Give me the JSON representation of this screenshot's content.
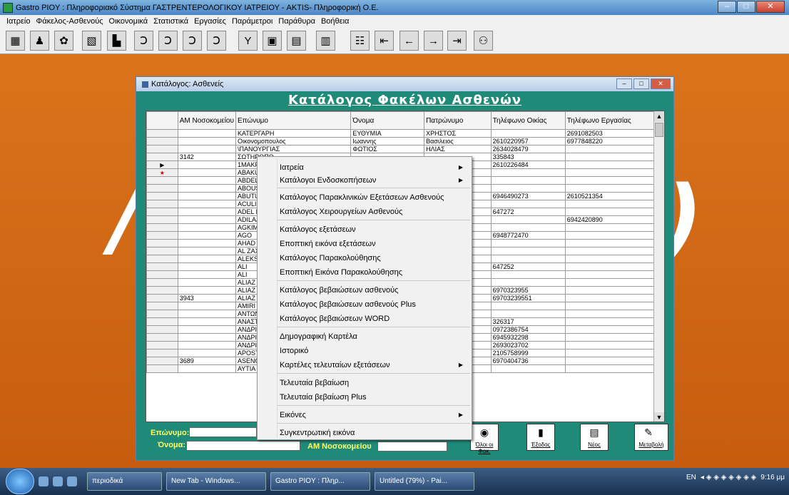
{
  "window": {
    "title": "Gastro PIOY : Πληροφοριακό Σύστημα ΓΑΣΤΡΕΝΤΕΡΟΛΟΓΙΚΟΥ ΙΑΤΡΕΙΟΥ  -    AKTIS- Πληροφορική Ο.Ε."
  },
  "menu": [
    "Ιατρείο",
    "Φάκελος-Ασθενούς",
    "Οικονομικά",
    "Στατιστικά",
    "Εργασίες",
    "Παράμετροι",
    "Παράθυρα",
    "Βοήθεια"
  ],
  "toolbar": {
    "icons": [
      "calculator-icon",
      "people-icon",
      "bag-icon",
      "puzzle-icon",
      "chart-icon",
      "organ-icon",
      "organ-icon",
      "organ-icon",
      "organ-icon",
      "y-icon",
      "monitor-icon",
      "calc-icon",
      "calc2-icon",
      "calendar-icon",
      "arrow-first-icon",
      "arrow-prev-icon",
      "arrow-next-icon",
      "arrow-last-icon",
      "users-icon",
      "exit-icon"
    ]
  },
  "child": {
    "title": "Κατάλογος: Ασθενείς",
    "heading": "Κατάλογος  Φακέλων Ασθενών"
  },
  "grid": {
    "headers": [
      "AM Νοσοκομείου",
      "Επώνυμο",
      "Όνομα",
      "Πατρώνυμο",
      "Τηλέφωνο Οικίας",
      "Τηλέφωνο Εργασίας"
    ],
    "rows": [
      [
        "",
        "",
        "ΚΑΤΕΡΓΑΡΗ",
        "ΕΥΘΥΜΙΑ",
        "ΧΡΗΣΤΟΣ",
        "",
        "2691082503"
      ],
      [
        "",
        "",
        "Οικονομοπουλος",
        "Ιωαννης",
        "Βασιλειος",
        "2610220957",
        "6977848220"
      ],
      [
        "",
        "",
        "\\ΠΑΝΟΥΡΓΙΑΣ",
        "ΦΩΤΙΟΣ",
        "ΗΛΙΑΣ",
        "2634028479",
        ""
      ],
      [
        "",
        "3142",
        "ΣΩΤΗΡΟΠΟ",
        "",
        "",
        "335843",
        ""
      ],
      [
        "▶",
        "",
        "1ΜΑΚΡΗ",
        "",
        "",
        "2610226484",
        ""
      ],
      [
        "★",
        "",
        "ΑΒΑΚUMOV",
        "",
        "",
        "",
        ""
      ],
      [
        "",
        "",
        "ABDELAZIZ",
        "",
        "",
        "",
        ""
      ],
      [
        "",
        "",
        "ABOUSHAN",
        "",
        "",
        "",
        ""
      ],
      [
        "",
        "",
        "ABUTURAB",
        "",
        "",
        "6946490273",
        "2610521354"
      ],
      [
        "",
        "",
        "ACULI",
        "",
        "",
        "",
        ""
      ],
      [
        "",
        "",
        "ADEL MOV",
        "",
        "",
        "647272",
        ""
      ],
      [
        "",
        "",
        "ADILAJ",
        "",
        "",
        "",
        "6942420890"
      ],
      [
        "",
        "",
        "AGKIM",
        "",
        "",
        "",
        ""
      ],
      [
        "",
        "",
        "AGO",
        "",
        "",
        "6948772470",
        ""
      ],
      [
        "",
        "",
        "AHAD",
        "",
        "ALI",
        "",
        ""
      ],
      [
        "",
        "",
        "AL ZAXIEN",
        "",
        "",
        "",
        ""
      ],
      [
        "",
        "",
        "ALEKSAND",
        "",
        "",
        "",
        ""
      ],
      [
        "",
        "",
        "ALI",
        "",
        "",
        "647252",
        ""
      ],
      [
        "",
        "",
        "ALI",
        "",
        "",
        "",
        ""
      ],
      [
        "",
        "",
        "ALIAZ",
        "",
        "",
        "",
        ""
      ],
      [
        "",
        "",
        "ALIAZ",
        "",
        "",
        "6970323955",
        ""
      ],
      [
        "",
        "3943",
        "ALIAZ",
        "",
        "",
        "69703239551",
        ""
      ],
      [
        "",
        "",
        "AMIRI",
        "",
        "",
        "",
        ""
      ],
      [
        "",
        "",
        "ΑΝΤΩΝΟΠ",
        "",
        "",
        "",
        ""
      ],
      [
        "",
        "",
        "ΑΝΑΣΤΑΣΟ",
        "",
        "",
        "326317",
        ""
      ],
      [
        "",
        "",
        "ΑΝΔΡΙΑΚΟΠ",
        "",
        "",
        "0972386754",
        ""
      ],
      [
        "",
        "",
        "ΑΝΔΡΙΑΝΟΙ",
        "",
        "",
        "6945932298",
        ""
      ],
      [
        "",
        "",
        "ΑΝΔΡΙΚΟΠΟ",
        "",
        "",
        "2693023702",
        ""
      ],
      [
        "",
        "",
        "APOSTOL",
        "",
        "",
        "2105758999",
        ""
      ],
      [
        "",
        "3689",
        "ASENOVA",
        "",
        "",
        "6970404736",
        ""
      ],
      [
        "",
        "",
        "AYTIA",
        "",
        "",
        "",
        ""
      ]
    ]
  },
  "search": {
    "surname_label": "Επώνυμο:",
    "name_label": "Όνομα:",
    "am_label": "AM Νοσοκομείου"
  },
  "buttons": {
    "all": "Όλοι οι Φακ.",
    "exit": "Έξοδος",
    "new": "Νέος",
    "transfer": "Μεταβολή"
  },
  "context_menu": [
    {
      "label": "Ιατρεία",
      "sub": true
    },
    {
      "label": "Κατάλογοι Ενδοσκοπήσεων",
      "sub": true
    },
    {
      "label": "Κατάλογος Παρακλινικών Εξετάσεων Ασθενούς",
      "sub": false
    },
    {
      "label": "Κατάλογος Χειρουργείων Ασθενούς",
      "sub": false
    },
    {
      "label": "Κατάλογος εξετάσεων",
      "sub": false
    },
    {
      "label": "Εποπτική εικόνα εξετάσεων",
      "sub": false
    },
    {
      "label": "Κατάλογος Παρακολούθησης",
      "sub": false
    },
    {
      "label": "Εποπτική Εικόνα Παρακολούθησης",
      "sub": false
    },
    {
      "label": "Κατάλογος βεβαιώσεων ασθενούς",
      "sub": false
    },
    {
      "label": "Κατάλογος βεβαιώσεων ασθενούς Plus",
      "sub": false
    },
    {
      "label": "Κατάλογος βεβαιώσεων WORD",
      "sub": false
    },
    {
      "label": "Δημογραφική Καρτέλα",
      "sub": false
    },
    {
      "label": "Ιστορικό",
      "sub": false
    },
    {
      "label": "Καρτέλες τελευταίων εξετάσεων",
      "sub": true
    },
    {
      "label": "Τελευταία βεβαίωση",
      "sub": false
    },
    {
      "label": "Τελευταία βεβαίωση Plus",
      "sub": false
    },
    {
      "label": "Εικόνες",
      "sub": true
    },
    {
      "label": "Συγκεντρωτική εικόνα",
      "sub": false
    }
  ],
  "taskbar": {
    "items": [
      "περιοδικά",
      "New Tab - Windows...",
      "Gastro PIOY : Πληρ...",
      "Untitled (79%) - Pai..."
    ],
    "lang": "EN",
    "time": "9:16 μμ"
  },
  "colors": {
    "desktop": "#d46a14",
    "child_bg": "#1f8a78",
    "label_yellow": "#ffff66"
  }
}
